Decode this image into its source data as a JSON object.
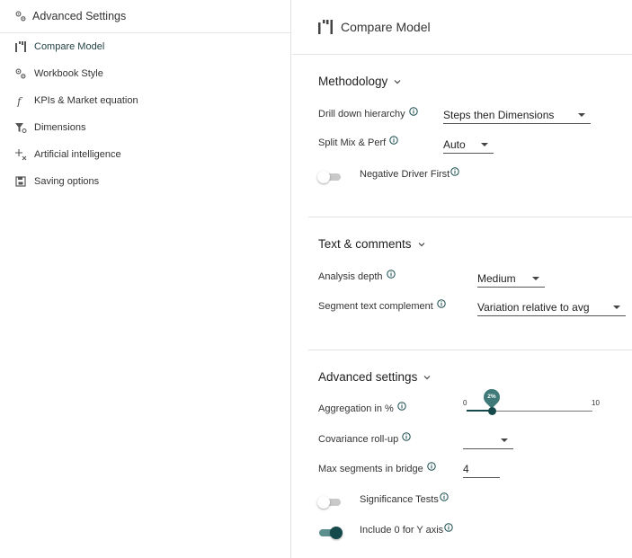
{
  "sidebar": {
    "title": "Advanced Settings",
    "title_icon": "settings-gear-icon",
    "items": [
      {
        "label": "Compare Model",
        "icon": "compare-model-icon",
        "active": true
      },
      {
        "label": "Workbook Style",
        "icon": "settings-gear-icon",
        "active": false
      },
      {
        "label": "KPIs & Market equation",
        "icon": "function-icon",
        "active": false
      },
      {
        "label": "Dimensions",
        "icon": "filter-settings-icon",
        "active": false
      },
      {
        "label": "Artificial intelligence",
        "icon": "ai-sparkle-icon",
        "active": false
      },
      {
        "label": "Saving options",
        "icon": "save-icon",
        "active": false
      }
    ]
  },
  "main": {
    "title": "Compare Model",
    "methodology": {
      "title": "Methodology",
      "drill_down": {
        "label": "Drill down hierarchy",
        "value": "Steps then Dimensions"
      },
      "split_mix": {
        "label": "Split Mix & Perf",
        "value": "Auto"
      },
      "negative_driver": {
        "label": "Negative Driver First",
        "on": false
      }
    },
    "text_comments": {
      "title": "Text & comments",
      "analysis_depth": {
        "label": "Analysis depth",
        "value": "Medium"
      },
      "segment_text": {
        "label": "Segment text complement",
        "value": "Variation relative to avg"
      }
    },
    "advanced": {
      "title": "Advanced settings",
      "aggregation": {
        "label": "Aggregation in %",
        "min": "0",
        "max": "10",
        "value": 2,
        "value_label": "2%"
      },
      "covariance": {
        "label": "Covariance roll-up",
        "value": ""
      },
      "max_segments": {
        "label": "Max segments in bridge",
        "value": "4"
      },
      "significance": {
        "label": "Significance Tests",
        "on": false
      },
      "include_zero": {
        "label": "Include 0 for Y axis",
        "on": true
      }
    }
  },
  "colors": {
    "accent": "#16494b",
    "accent_light": "#5a8f8e",
    "divider": "#e2e2e2"
  }
}
